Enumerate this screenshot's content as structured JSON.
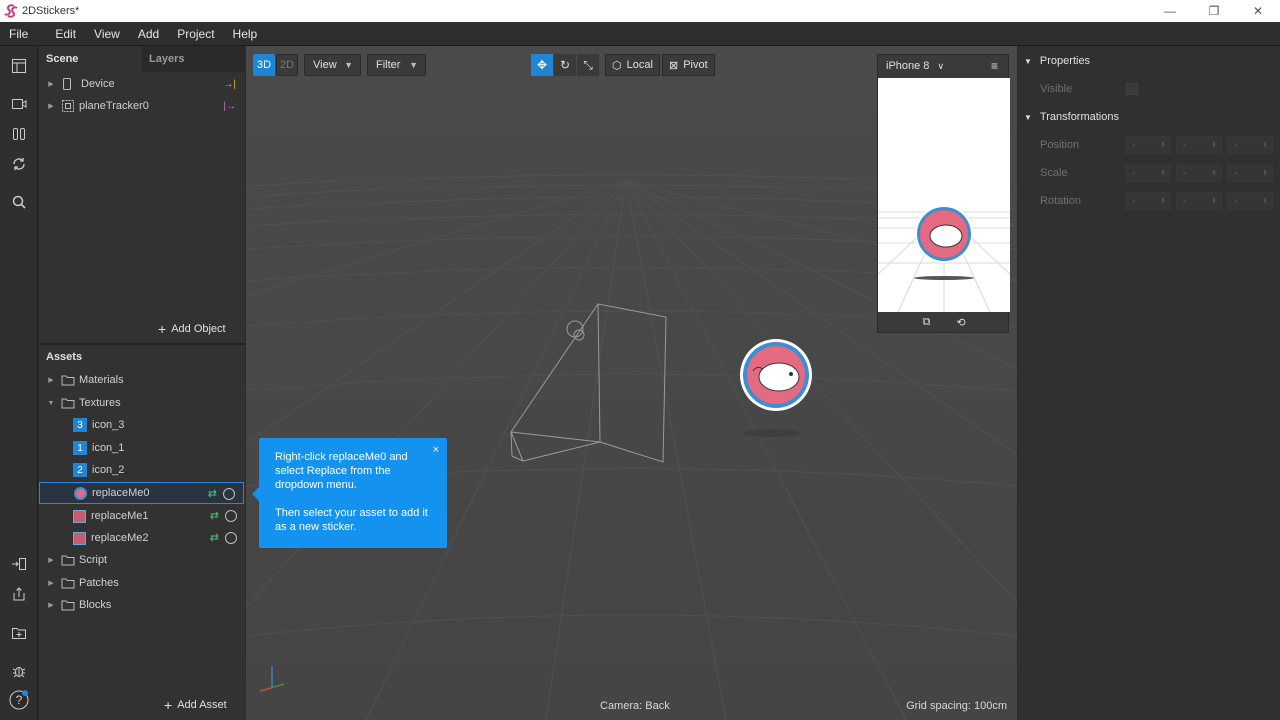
{
  "window": {
    "title": "2DStickers*"
  },
  "menu": [
    "File",
    "Edit",
    "View",
    "Add",
    "Project",
    "Help"
  ],
  "scene_panel": {
    "tabs": [
      "Scene",
      "Layers"
    ],
    "items": [
      {
        "label": "Device"
      },
      {
        "label": "planeTracker0"
      }
    ],
    "add_object_label": "Add Object"
  },
  "assets_panel": {
    "title": "Assets",
    "folders_top": [
      "Materials",
      "Textures"
    ],
    "textures": [
      {
        "badge": "3",
        "label": "icon_3"
      },
      {
        "badge": "1",
        "label": "icon_1"
      },
      {
        "badge": "2",
        "label": "icon_2"
      },
      {
        "label": "replaceMe0",
        "selected": true
      },
      {
        "label": "replaceMe1"
      },
      {
        "label": "replaceMe2"
      }
    ],
    "folders_bottom": [
      "Script",
      "Patches",
      "Blocks"
    ],
    "add_asset_label": "Add Asset"
  },
  "viewport": {
    "mode_3d": "3D",
    "mode_2d": "2D",
    "view_label": "View",
    "filter_label": "Filter",
    "local_label": "Local",
    "pivot_label": "Pivot",
    "device": "iPhone 8",
    "camera_label": "Camera: Back",
    "grid_label": "Grid spacing: 100cm"
  },
  "tooltip": {
    "line1": "Right-click replaceMe0 and select Replace from the dropdown menu.",
    "line2": "Then select your asset to add it as a new sticker.",
    "close": "×"
  },
  "properties": {
    "title": "Properties",
    "visible_label": "Visible",
    "transform_title": "Transformations",
    "rows": [
      "Position",
      "Scale",
      "Rotation"
    ],
    "placeholder": "-"
  },
  "colors": {
    "accent": "#1f86d6",
    "tooltip": "#1392f0",
    "sticker_pink": "#e46a82",
    "sticker_ring": "#3a8fd0"
  }
}
